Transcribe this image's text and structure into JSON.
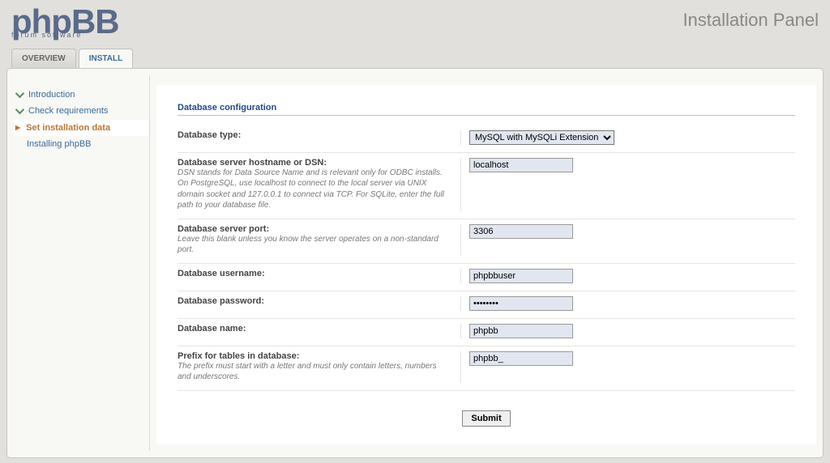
{
  "header": {
    "logo_top": "phpBB",
    "logo_sub": "forum   software",
    "panel_title": "Installation Panel"
  },
  "tabs": [
    {
      "key": "overview",
      "label": "OVERVIEW",
      "active": false
    },
    {
      "key": "install",
      "label": "INSTALL",
      "active": true
    }
  ],
  "sidebar": {
    "items": [
      {
        "label": "Introduction",
        "state": "done"
      },
      {
        "label": "Check requirements",
        "state": "done"
      },
      {
        "label": "Set installation data",
        "state": "current"
      },
      {
        "label": "Installing phpBB",
        "state": "pending"
      }
    ]
  },
  "section_title": "Database configuration",
  "fields": {
    "dbtype": {
      "label": "Database type:",
      "value": "MySQL with MySQLi Extension"
    },
    "dbhost": {
      "label": "Database server hostname or DSN:",
      "help": "DSN stands for Data Source Name and is relevant only for ODBC installs. On PostgreSQL, use localhost to connect to the local server via UNIX domain socket and 127.0.0.1 to connect via TCP. For SQLite, enter the full path to your database file.",
      "value": "localhost"
    },
    "dbport": {
      "label": "Database server port:",
      "help": "Leave this blank unless you know the server operates on a non-standard port.",
      "value": "3306"
    },
    "dbuser": {
      "label": "Database username:",
      "value": "phpbbuser"
    },
    "dbpass": {
      "label": "Database password:",
      "value": "••••••••"
    },
    "dbname": {
      "label": "Database name:",
      "value": "phpbb"
    },
    "tblprefix": {
      "label": "Prefix for tables in database:",
      "help": "The prefix must start with a letter and must only contain letters, numbers and underscores.",
      "value": "phpbb_"
    }
  },
  "submit_label": "Submit"
}
